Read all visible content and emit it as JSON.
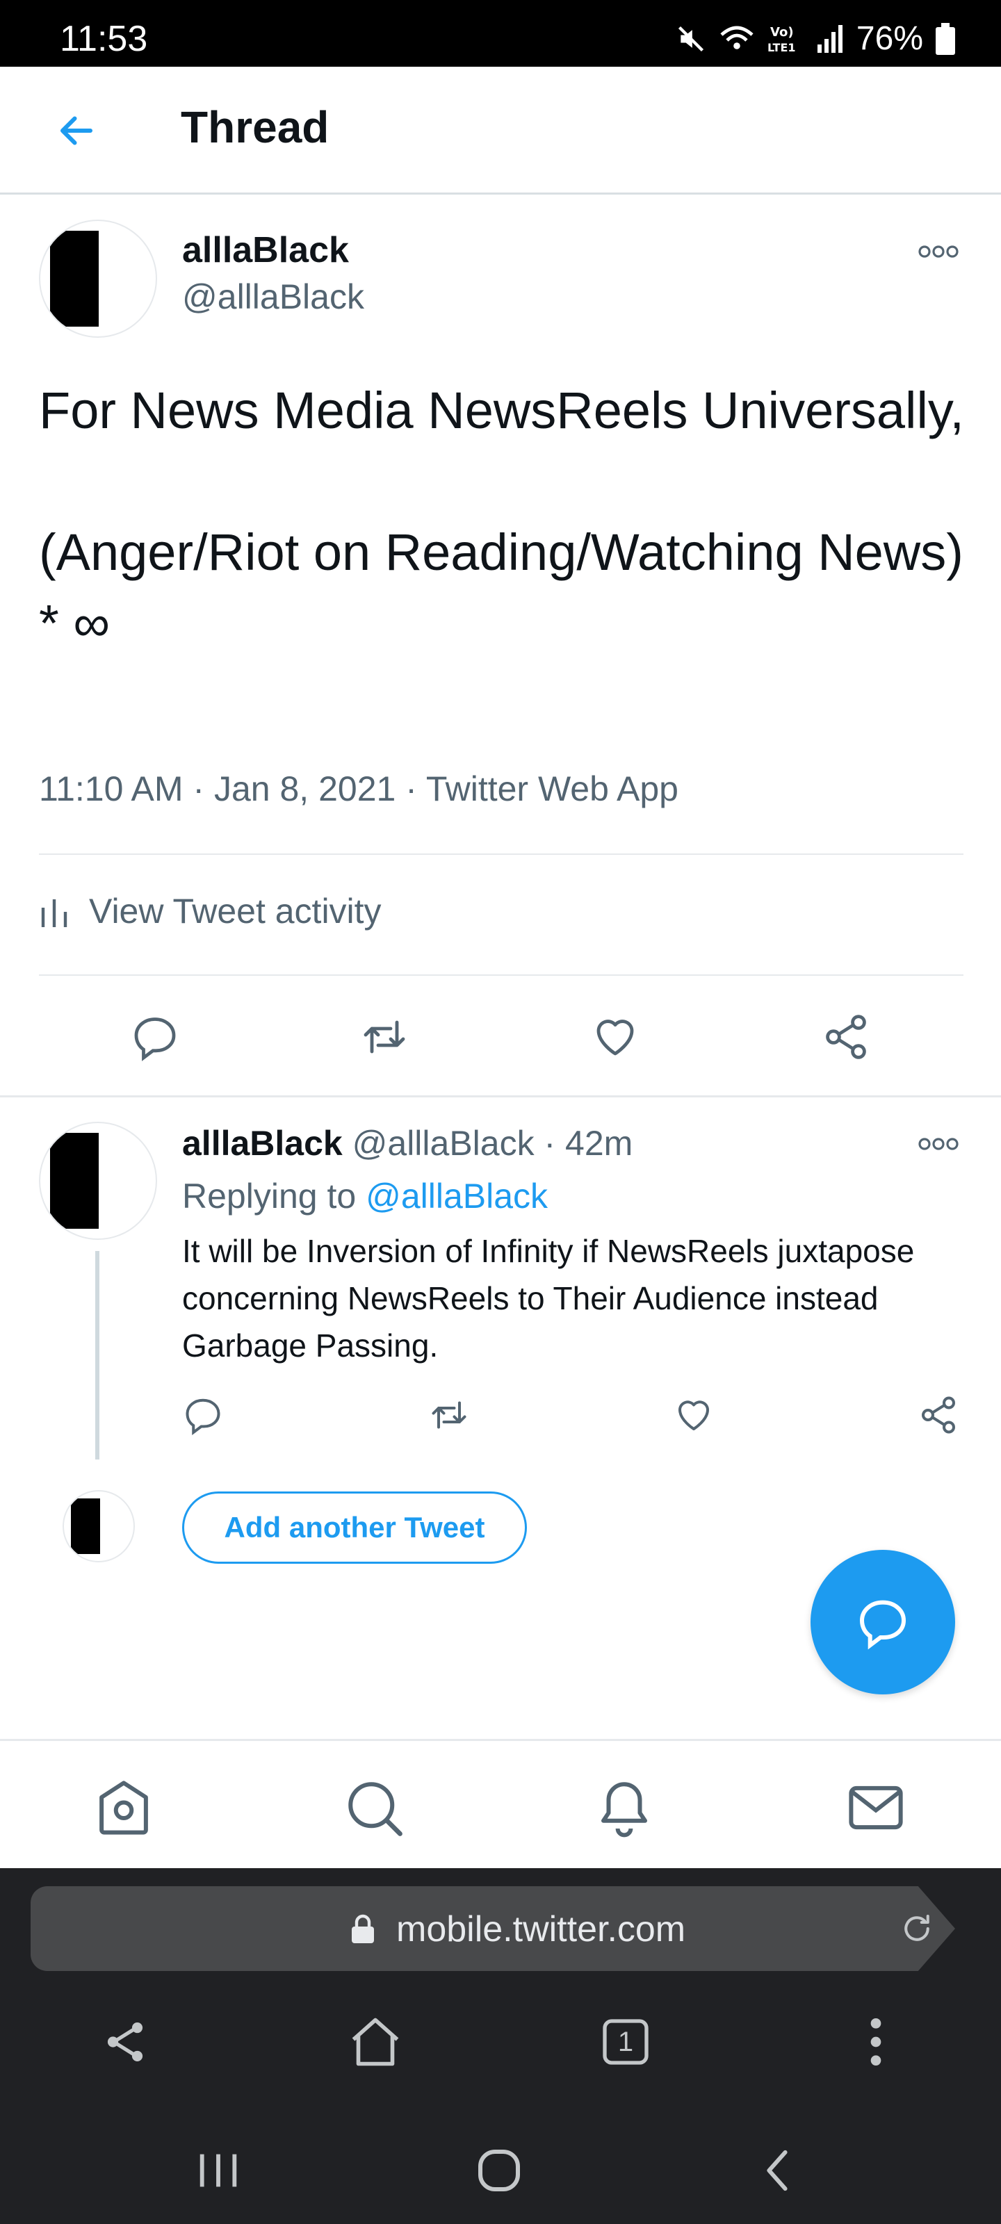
{
  "status_bar": {
    "time": "11:53",
    "battery": "76%",
    "icons": [
      "mute-icon",
      "wifi-icon",
      "volte-lte-icon",
      "signal-icon",
      "battery-icon"
    ]
  },
  "header": {
    "title": "Thread",
    "back_icon": "arrow-left-icon"
  },
  "main_tweet": {
    "display_name": "alllaBlack",
    "handle": "@alllaBlack",
    "text": "For News Media NewsReels Universally,\n\n(Anger/Riot on Reading/Watching News) * ∞",
    "meta": "11:10 AM · Jan 8, 2021 · Twitter Web App",
    "activity_label": "View Tweet activity",
    "actions": [
      "reply-icon",
      "retweet-icon",
      "like-icon",
      "share-icon"
    ]
  },
  "reply": {
    "display_name": "alllaBlack",
    "handle": "@alllaBlack",
    "time": "· 42m",
    "replying_prefix": "Replying to",
    "replying_handle": "@alllaBlack",
    "text": "It will be Inversion of Infinity if NewsReels juxtapose concerning NewsReels to Their Audience instead Garbage Passing."
  },
  "add_tweet_label": "Add another Tweet",
  "bottom_nav": [
    "home-icon",
    "search-icon",
    "notifications-icon",
    "messages-icon"
  ],
  "browser": {
    "url": "mobile.twitter.com",
    "tab_count": "1"
  },
  "colors": {
    "accent": "#1d9bf0",
    "text": "#0f1419",
    "secondary": "#536471"
  }
}
